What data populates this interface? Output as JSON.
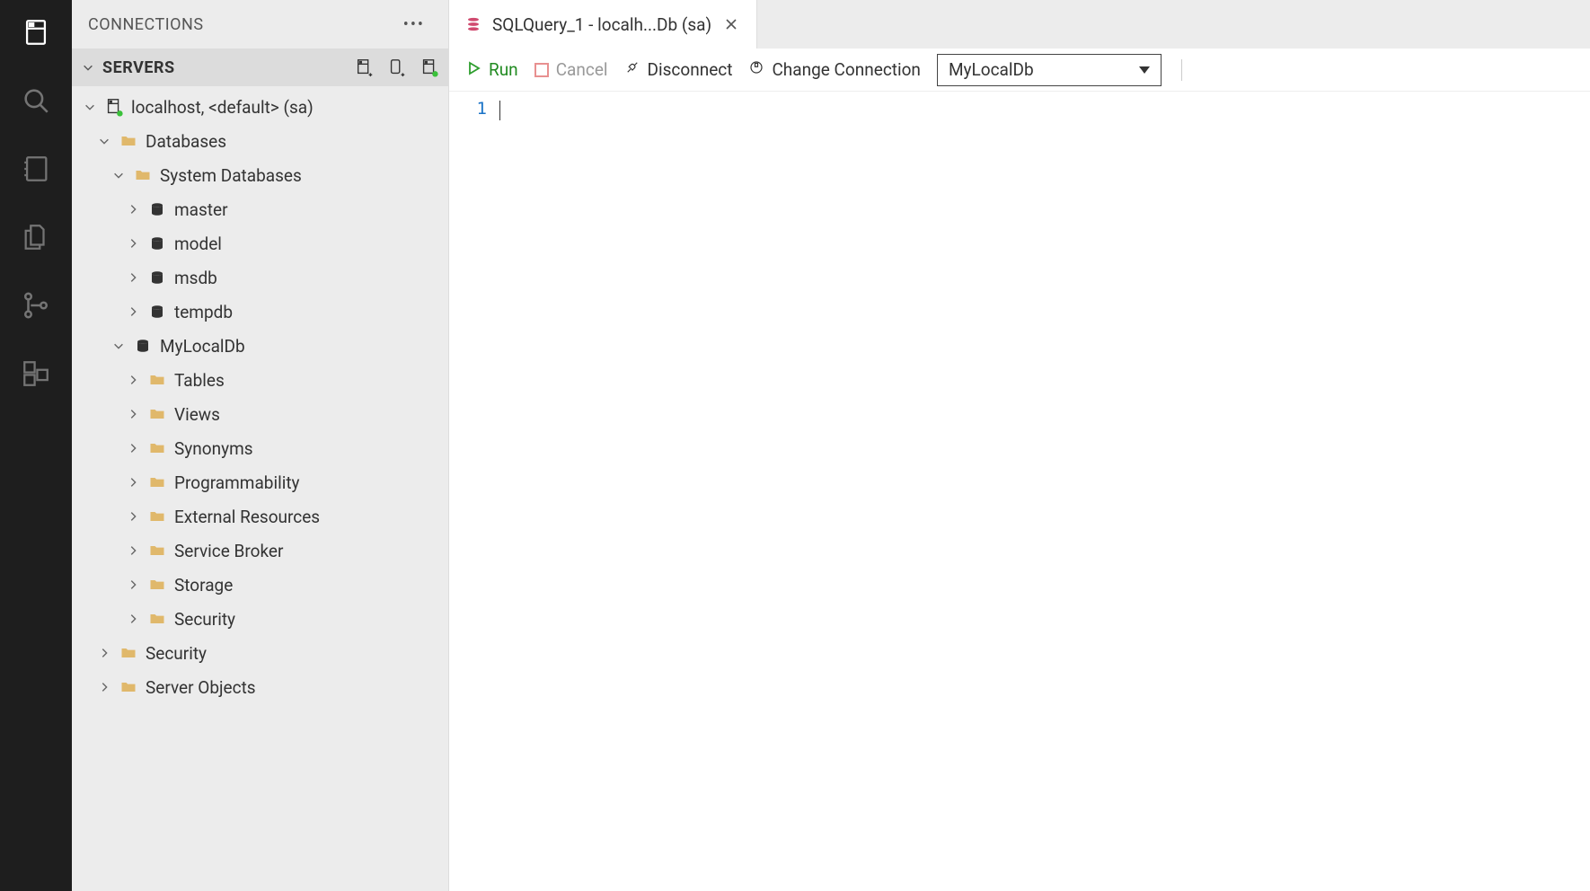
{
  "sidebar": {
    "title": "CONNECTIONS",
    "servers_label": "SERVERS"
  },
  "tree": {
    "server": {
      "label": "localhost, <default> (sa)"
    },
    "databases": {
      "label": "Databases"
    },
    "system_databases": {
      "label": "System Databases"
    },
    "sys_dbs": [
      {
        "label": "master"
      },
      {
        "label": "model"
      },
      {
        "label": "msdb"
      },
      {
        "label": "tempdb"
      }
    ],
    "user_db": {
      "label": "MyLocalDb"
    },
    "user_db_children": [
      {
        "label": "Tables"
      },
      {
        "label": "Views"
      },
      {
        "label": "Synonyms"
      },
      {
        "label": "Programmability"
      },
      {
        "label": "External Resources"
      },
      {
        "label": "Service Broker"
      },
      {
        "label": "Storage"
      },
      {
        "label": "Security"
      }
    ],
    "server_security": {
      "label": "Security"
    },
    "server_objects": {
      "label": "Server Objects"
    }
  },
  "tab": {
    "title": "SQLQuery_1 - localh...Db (sa)"
  },
  "toolbar": {
    "run": "Run",
    "cancel": "Cancel",
    "disconnect": "Disconnect",
    "change_connection": "Change Connection",
    "db_selected": "MyLocalDb"
  },
  "editor": {
    "line_number": "1"
  }
}
